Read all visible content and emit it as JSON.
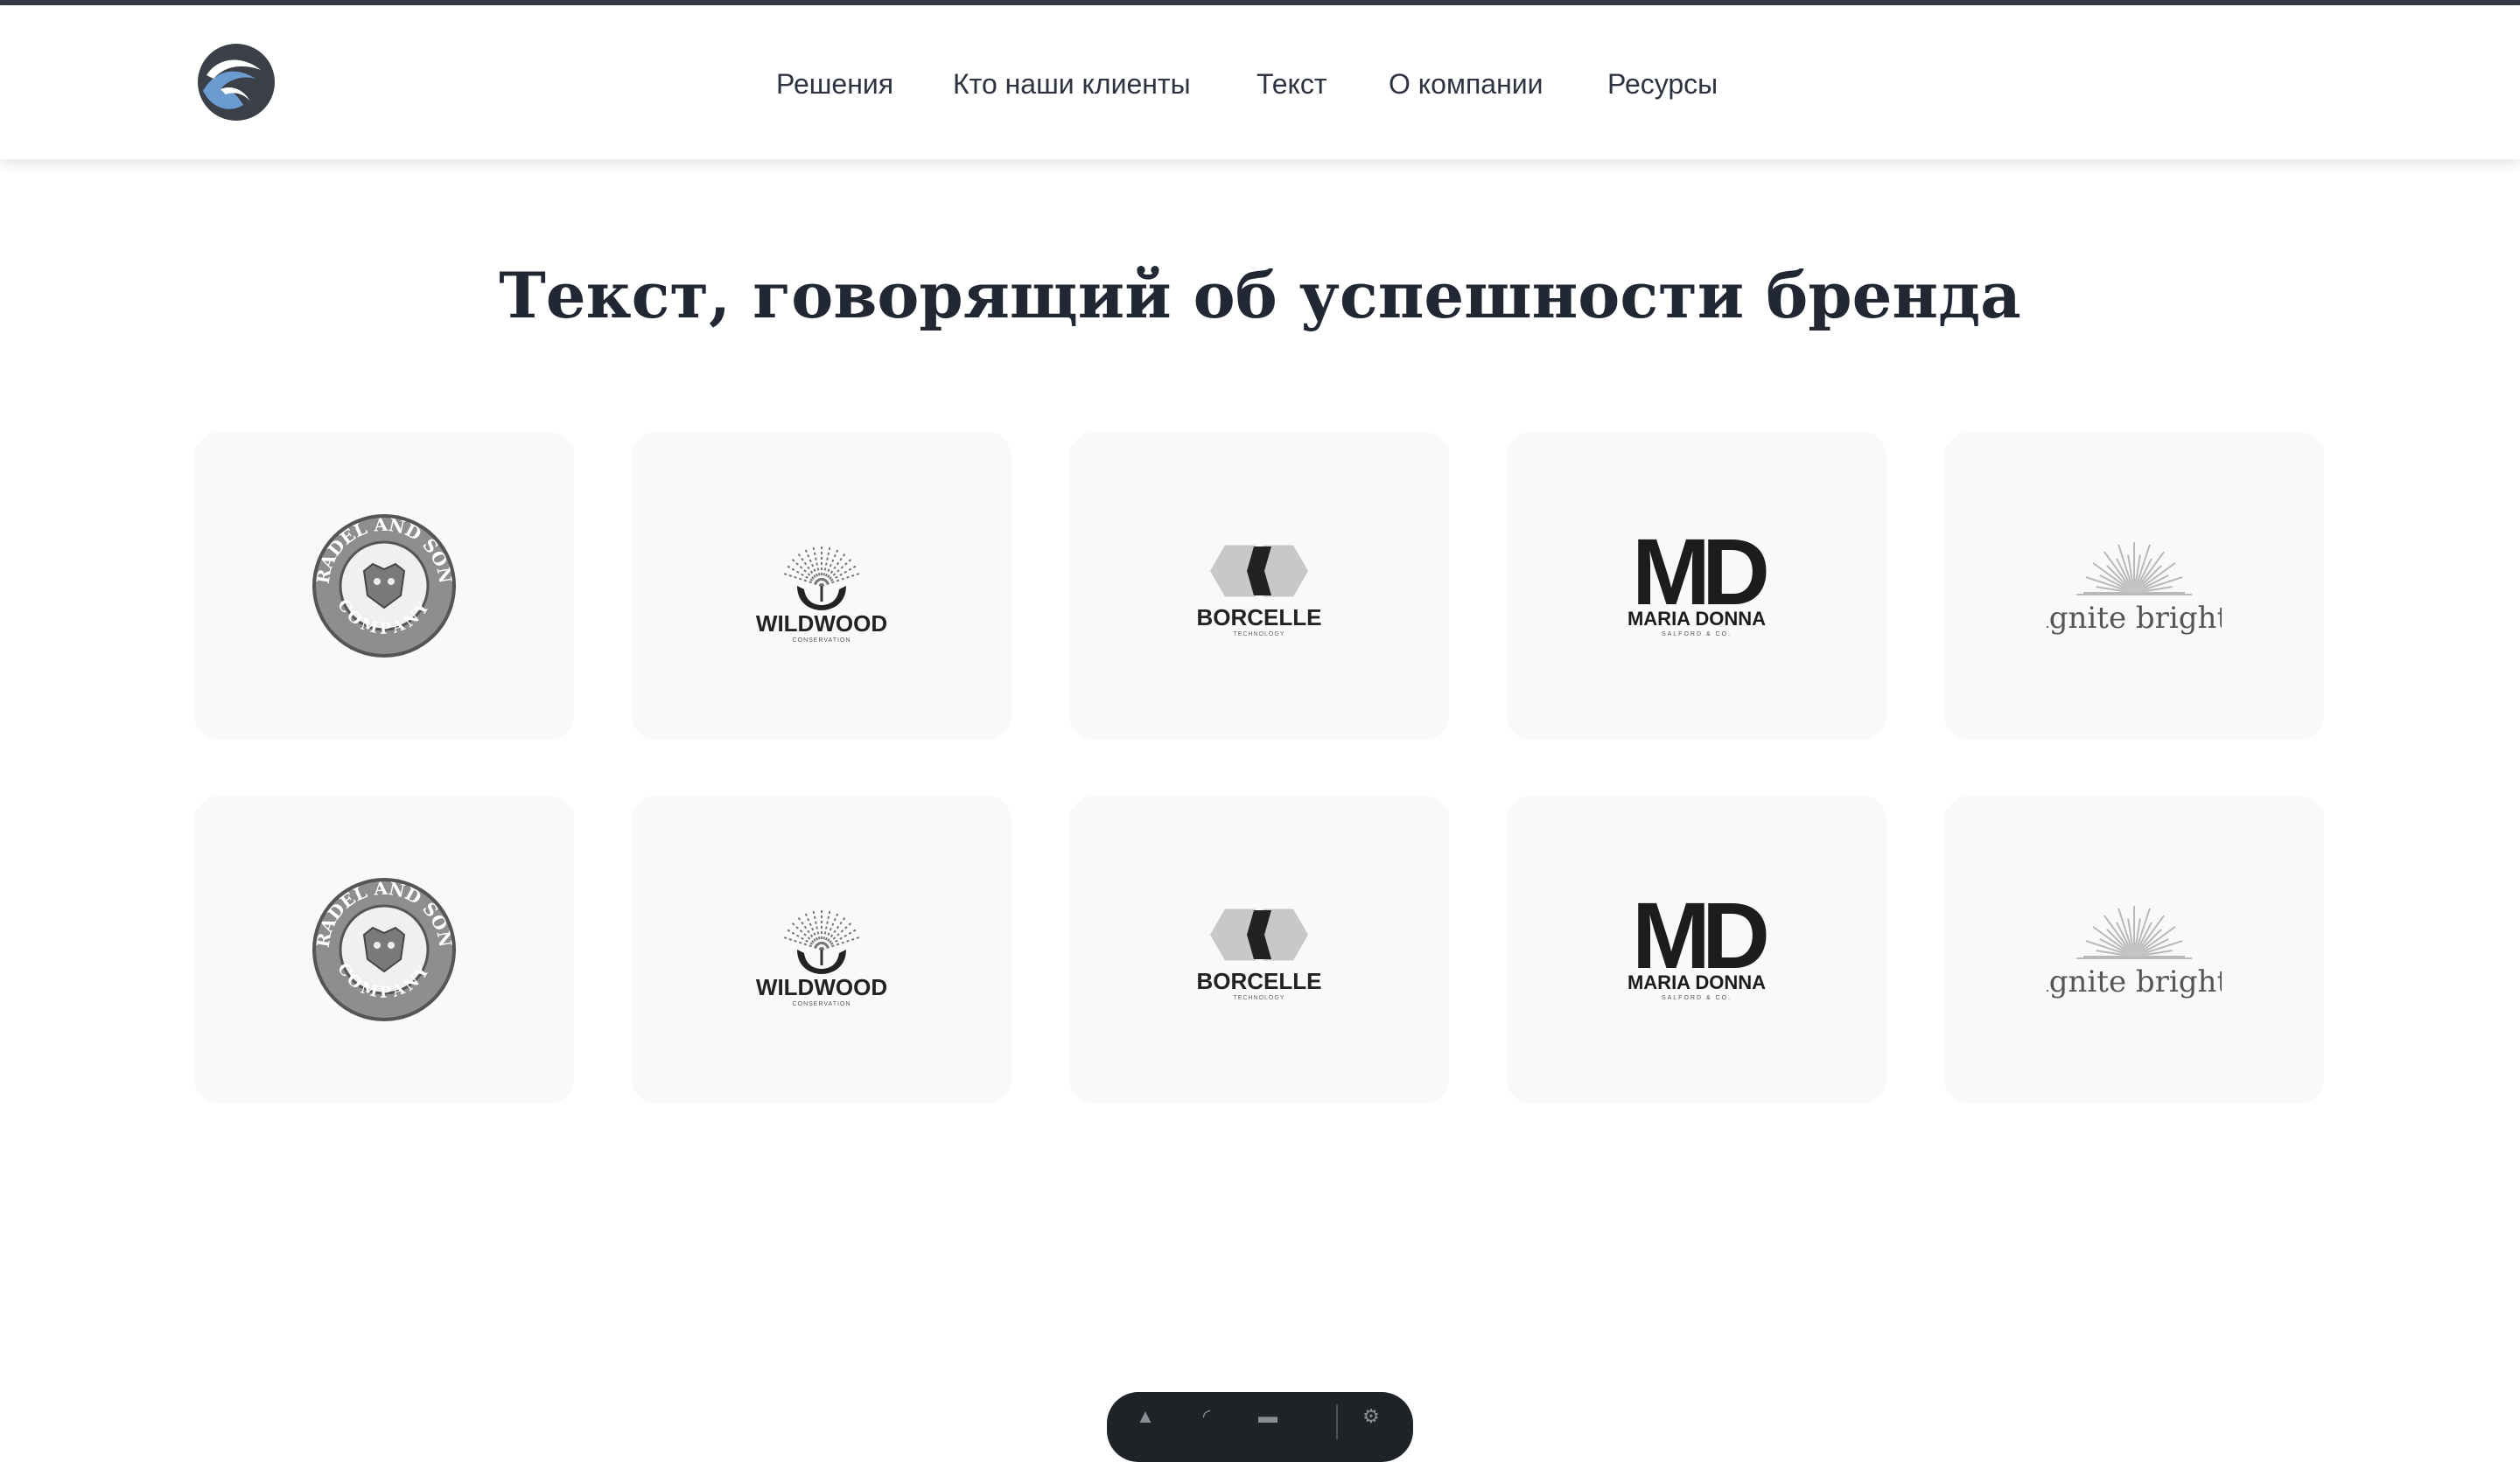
{
  "header": {
    "logo_icon": "swoosh-logo-icon",
    "nav": [
      {
        "label": "Решения"
      },
      {
        "label": "Кто наши клиенты"
      },
      {
        "label": "Текст"
      },
      {
        "label": "О компании"
      },
      {
        "label": "Ресурсы"
      }
    ]
  },
  "main": {
    "title": "Текст, говорящий об успешности бренда"
  },
  "logos": {
    "rows": [
      [
        {
          "kind": "fradel",
          "ring_top": "FRADEL AND SONS",
          "ring_bottom": "COMPANY"
        },
        {
          "kind": "wildwood",
          "name": "WILDWOOD",
          "sub": "CONSERVATION"
        },
        {
          "kind": "borcelle",
          "name": "BORCELLE",
          "sub": "TECHNOLOGY"
        },
        {
          "kind": "mariadonna",
          "mark": "MD",
          "name": "MARIA DONNA",
          "sub": "SALFORD & CO."
        },
        {
          "kind": "ignite",
          "name": "ignite bright"
        }
      ],
      [
        {
          "kind": "fradel",
          "ring_top": "FRADEL AND SONS",
          "ring_bottom": "COMPANY"
        },
        {
          "kind": "wildwood",
          "name": "WILDWOOD",
          "sub": "CONSERVATION"
        },
        {
          "kind": "borcelle",
          "name": "BORCELLE",
          "sub": "TECHNOLOGY"
        },
        {
          "kind": "mariadonna",
          "mark": "MD",
          "name": "MARIA DONNA",
          "sub": "SALFORD & CO."
        },
        {
          "kind": "ignite",
          "name": "ignite bright"
        }
      ]
    ]
  },
  "colors": {
    "accent_blue": "#6b9bd1",
    "dark": "#353a44",
    "card_bg": "#f8f9fb"
  }
}
